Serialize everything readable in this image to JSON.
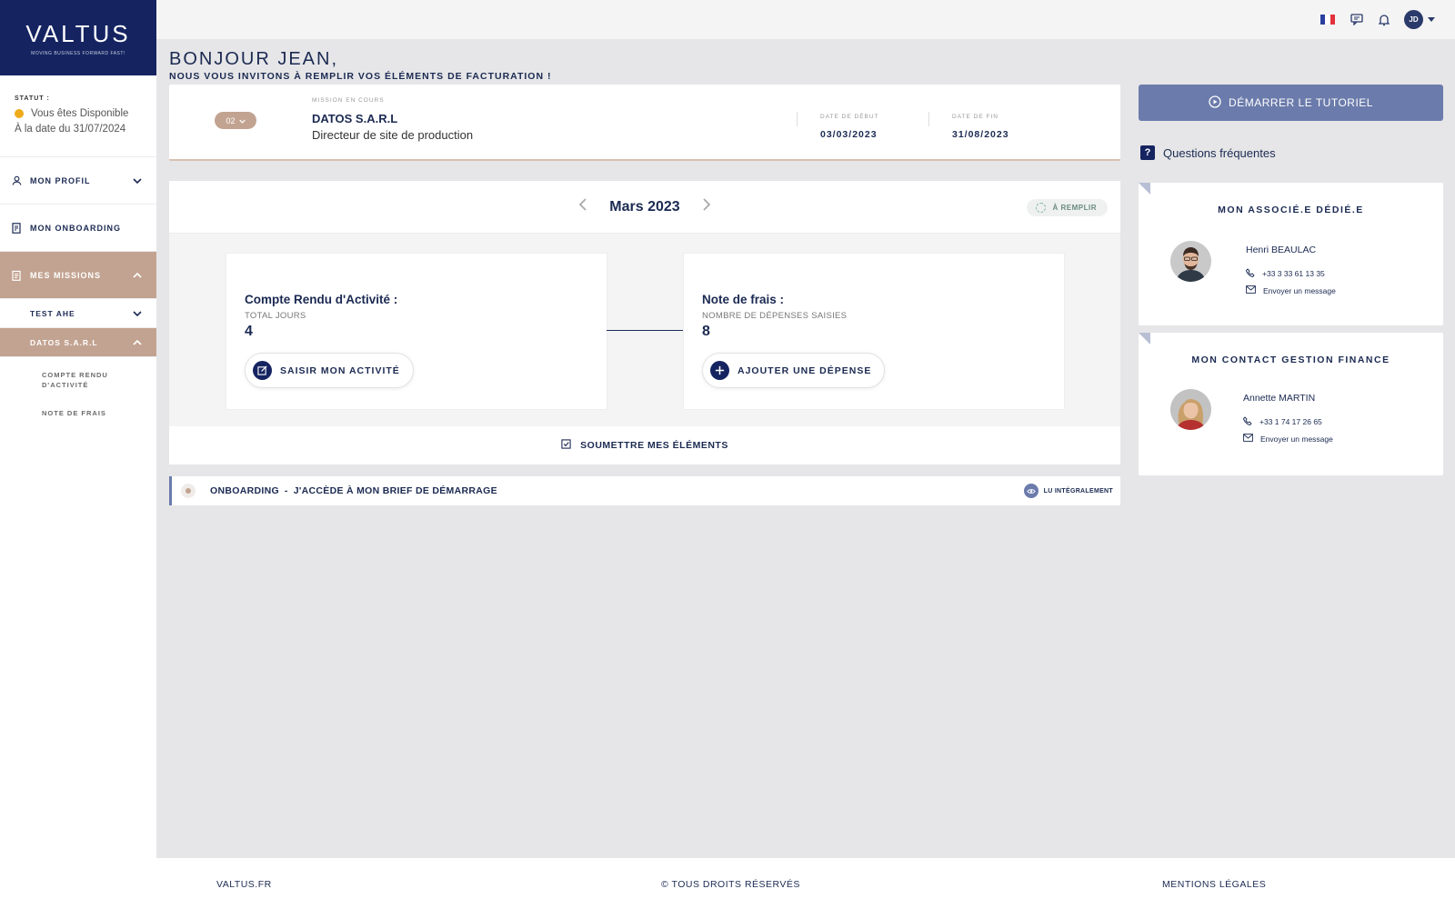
{
  "brand": {
    "name": "VALTUS",
    "tagline": "MOVING BUSINESS FORWARD FAST!"
  },
  "sidebar": {
    "status_label": "STATUT :",
    "status_text": "Vous êtes Disponible",
    "status_date": "À la date du 31/07/2024",
    "status_color": "#f0ab1c",
    "items": [
      {
        "label": "MON PROFIL",
        "icon": "user-icon"
      },
      {
        "label": "MON ONBOARDING",
        "icon": "document-icon"
      },
      {
        "label": "MES MISSIONS",
        "icon": "clipboard-icon"
      }
    ],
    "missions": [
      {
        "label": "TEST AHE"
      },
      {
        "label": "DATOS S.A.R.L"
      }
    ],
    "sub_items": [
      {
        "label": "COMPTE RENDU D'ACTIVITÉ"
      },
      {
        "label": "NOTE DE FRAIS"
      }
    ]
  },
  "topbar": {
    "avatar_initials": "JD"
  },
  "greeting": {
    "title": "BONJOUR JEAN,",
    "subtitle": "NOUS VOUS INVITONS À REMPLIR VOS ÉLÉMENTS DE FACTURATION !"
  },
  "mission": {
    "badge": "02",
    "label": "MISSION EN COURS",
    "company": "DATOS S.A.R.L",
    "role": "Directeur de site de production",
    "start_label": "DATE DE DÉBUT",
    "start_date": "03/03/2023",
    "end_label": "DATE DE FIN",
    "end_date": "31/08/2023"
  },
  "period": {
    "month": "Mars 2023",
    "status": "À REMPLIR"
  },
  "activity": {
    "title": "Compte Rendu d'Activité :",
    "sub": "TOTAL JOURS",
    "value": "4",
    "button": "SAISIR MON ACTIVITÉ"
  },
  "expenses": {
    "title": "Note de frais :",
    "sub": "NOMBRE DE DÉPENSES SAISIES",
    "value": "8",
    "button": "AJOUTER UNE DÉPENSE"
  },
  "submit_label": "SOUMETTRE MES ÉLÉMENTS",
  "onboarding": {
    "prefix": "ONBOARDING",
    "title": "J'ACCÈDE À MON BRIEF DE DÉMARRAGE",
    "status": "LU INTÉGRALEMENT"
  },
  "right": {
    "tutorial_button": "DÉMARRER LE TUTORIEL",
    "faq_label": "Questions fréquentes"
  },
  "contacts": [
    {
      "title": "MON ASSOCIÉ.E DÉDIÉ.E",
      "name": "Henri BEAULAC",
      "phone": "+33 3 33 61 13 35",
      "message": "Envoyer un message"
    },
    {
      "title": "MON CONTACT GESTION FINANCE",
      "name": "Annette MARTIN",
      "phone": "+33 1 74 17 26 65",
      "message": "Envoyer un message"
    }
  ],
  "footer": {
    "site": "VALTUS.FR",
    "rights": "© TOUS DROITS RÉSERVÉS",
    "legal": "MENTIONS LÉGALES"
  }
}
